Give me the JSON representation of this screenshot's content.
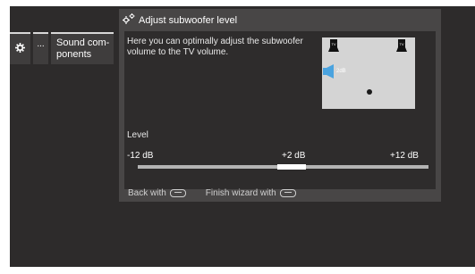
{
  "breadcrumb": {
    "settings_icon": "gear-icon",
    "more_label": "...",
    "sound_label": "Sound com-\nponents"
  },
  "panel": {
    "icon": "gears-icon",
    "title": "Adjust subwoofer level",
    "description": "Here you can optimally adjust the subwoofer volume to the TV volume.",
    "diagram": {
      "tv_left_label": "TV",
      "tv_right_label": "TV",
      "subwoofer_level": "2dB",
      "subwoofer_color": "#4aa3df"
    },
    "level": {
      "label": "Level",
      "min_label": "-12 dB",
      "current_label": "+2 dB",
      "max_label": "+12 dB",
      "value_db": 2,
      "min_db": -12,
      "max_db": 12
    },
    "footer": {
      "back_text": "Back with",
      "back_button_icon": "back-button-icon",
      "finish_text": "Finish wizard with",
      "finish_button_icon": "end-button-icon"
    }
  }
}
